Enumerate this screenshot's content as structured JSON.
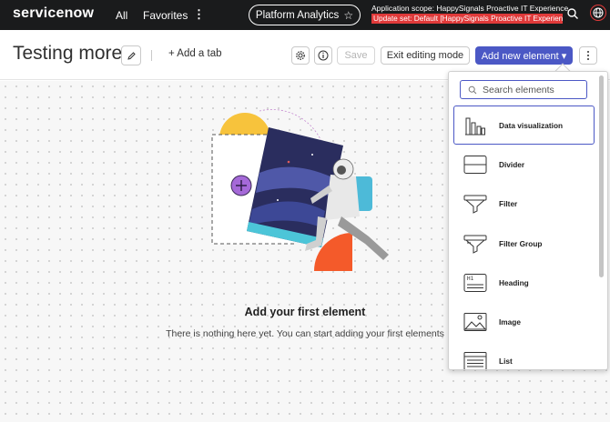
{
  "nav": {
    "logo": "servicenow",
    "all_label": "All",
    "favorites_label": "Favorites",
    "more_label": "⋮",
    "app_pill_label": "Platform Analytics",
    "scope_text": "Application scope: HappySignals Proactive IT Experience",
    "update_set_text": "Update set: Default [HappySignals Proactive IT Experienc..."
  },
  "header": {
    "title": "Testing more",
    "add_tab_label": "+ Add a tab",
    "save_label": "Save",
    "exit_label": "Exit editing mode",
    "add_element_label": "Add new element ▾"
  },
  "canvas": {
    "empty_title": "Add your first element",
    "empty_subtitle": "There is nothing here yet. You can start adding your first elements"
  },
  "panel": {
    "search_placeholder": "Search elements",
    "items": [
      {
        "label": "Data visualization",
        "icon": "bar-chart-icon",
        "selected": true
      },
      {
        "label": "Divider",
        "icon": "divider-icon",
        "selected": false
      },
      {
        "label": "Filter",
        "icon": "filter-icon",
        "selected": false
      },
      {
        "label": "Filter Group",
        "icon": "filter-group-icon",
        "selected": false
      },
      {
        "label": "Heading",
        "icon": "heading-icon",
        "selected": false
      },
      {
        "label": "Image",
        "icon": "image-icon",
        "selected": false
      },
      {
        "label": "List",
        "icon": "list-icon",
        "selected": false
      }
    ]
  },
  "colors": {
    "nav_bg": "#1a1b1c",
    "accent": "#4b58c5",
    "update_set_bg": "#e03a3a"
  }
}
